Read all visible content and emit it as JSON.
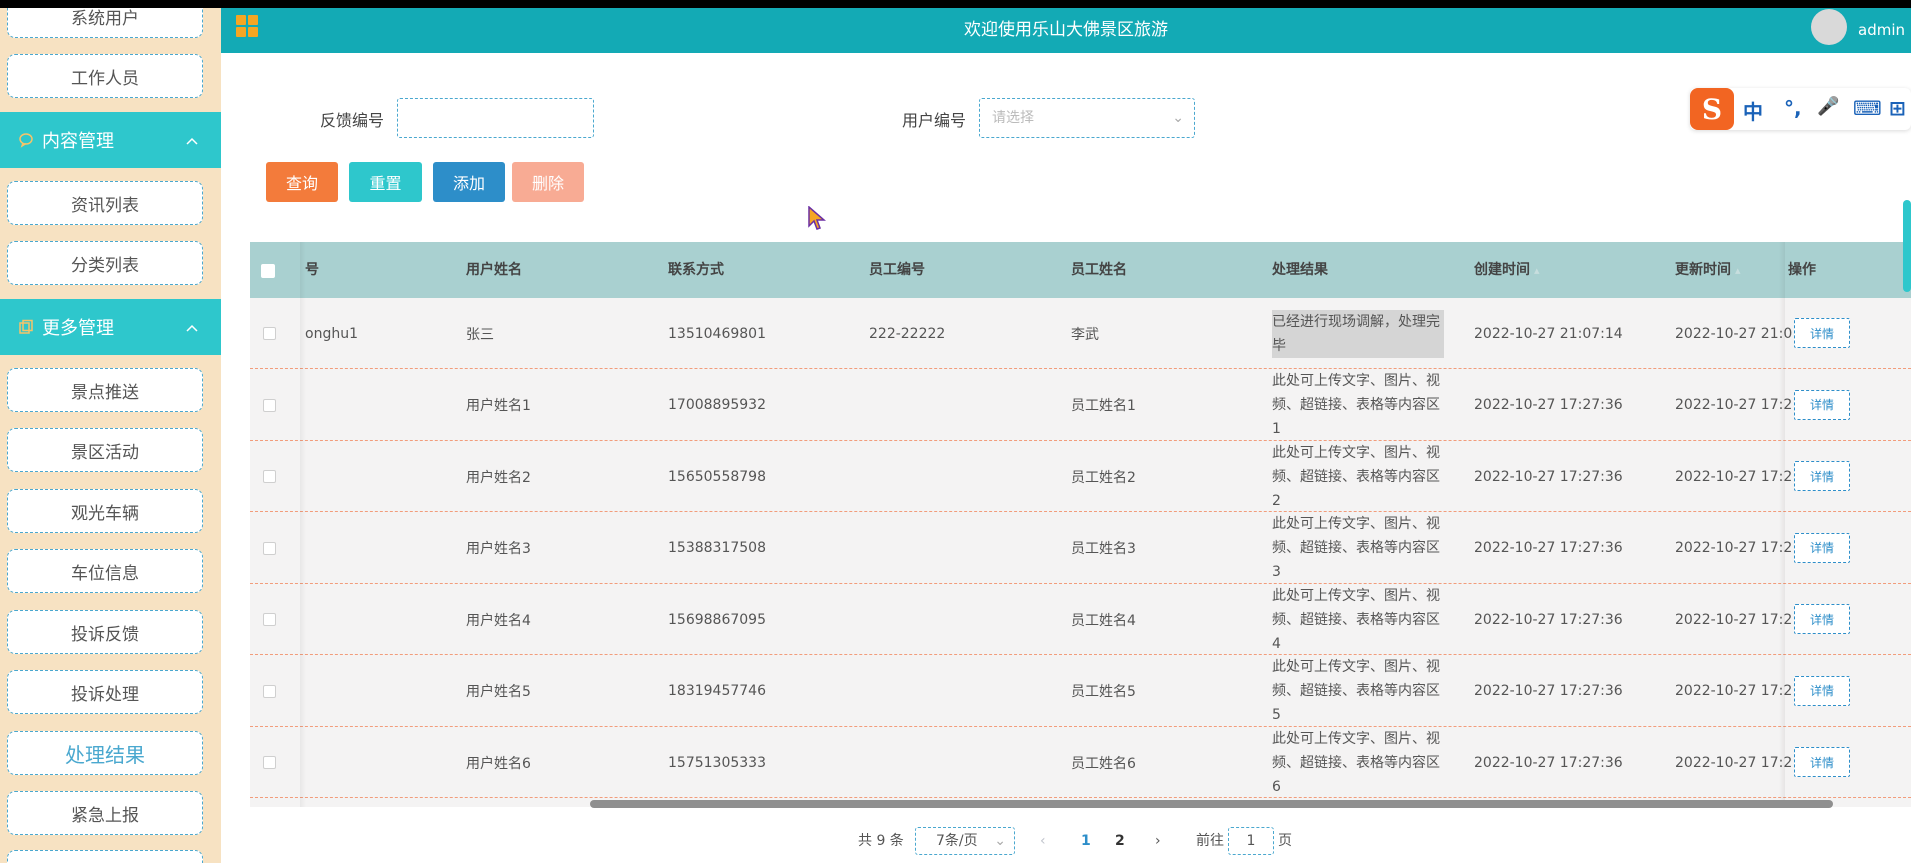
{
  "header": {
    "title": "欢迎使用乐山大佛景区旅游",
    "user": "admin"
  },
  "sidebar": {
    "items_top": [
      {
        "label": "系统用户"
      },
      {
        "label": "工作人员"
      }
    ],
    "group_content": {
      "label": "内容管理"
    },
    "items_content": [
      {
        "label": "资讯列表"
      },
      {
        "label": "分类列表"
      }
    ],
    "group_more": {
      "label": "更多管理"
    },
    "items_more": [
      {
        "label": "景点推送"
      },
      {
        "label": "景区活动"
      },
      {
        "label": "观光车辆"
      },
      {
        "label": "车位信息"
      },
      {
        "label": "投诉反馈"
      },
      {
        "label": "投诉处理"
      },
      {
        "label": "处理结果",
        "active": true
      },
      {
        "label": "紧急上报"
      }
    ]
  },
  "search": {
    "feedback_label": "反馈编号",
    "feedback_value": "",
    "user_label": "用户编号",
    "user_placeholder": "请选择"
  },
  "buttons": {
    "query": "查询",
    "reset": "重置",
    "add": "添加",
    "delete": "删除"
  },
  "ime": {
    "logo": "S",
    "items": [
      "中",
      "°,",
      "🎤",
      "⌨",
      "⊞"
    ]
  },
  "table": {
    "columns": {
      "feedback_no": "号",
      "user_name": "用户姓名",
      "contact": "联系方式",
      "staff_no": "员工编号",
      "staff_name": "员工姓名",
      "result": "处理结果",
      "created": "创建时间",
      "updated": "更新时间",
      "action": "操作"
    },
    "rows": [
      {
        "feedback_no": "onghu1",
        "user_name": "张三",
        "contact": "13510469801",
        "staff_no": "222-22222",
        "staff_name": "李武",
        "result": "已经进行现场调解，处理完毕",
        "created": "2022-10-27 21:07:14",
        "updated": "2022-10-27 21:0",
        "action": "详情"
      },
      {
        "feedback_no": "",
        "user_name": "用户姓名1",
        "contact": "17008895932",
        "staff_no": "",
        "staff_name": "员工姓名1",
        "result": "此处可上传文字、图片、视频、超链接、表格等内容区1",
        "created": "2022-10-27 17:27:36",
        "updated": "2022-10-27 17:2",
        "action": "详情"
      },
      {
        "feedback_no": "",
        "user_name": "用户姓名2",
        "contact": "15650558798",
        "staff_no": "",
        "staff_name": "员工姓名2",
        "result": "此处可上传文字、图片、视频、超链接、表格等内容区2",
        "created": "2022-10-27 17:27:36",
        "updated": "2022-10-27 17:2",
        "action": "详情"
      },
      {
        "feedback_no": "",
        "user_name": "用户姓名3",
        "contact": "15388317508",
        "staff_no": "",
        "staff_name": "员工姓名3",
        "result": "此处可上传文字、图片、视频、超链接、表格等内容区3",
        "created": "2022-10-27 17:27:36",
        "updated": "2022-10-27 17:2",
        "action": "详情"
      },
      {
        "feedback_no": "",
        "user_name": "用户姓名4",
        "contact": "15698867095",
        "staff_no": "",
        "staff_name": "员工姓名4",
        "result": "此处可上传文字、图片、视频、超链接、表格等内容区4",
        "created": "2022-10-27 17:27:36",
        "updated": "2022-10-27 17:2",
        "action": "详情"
      },
      {
        "feedback_no": "",
        "user_name": "用户姓名5",
        "contact": "18319457746",
        "staff_no": "",
        "staff_name": "员工姓名5",
        "result": "此处可上传文字、图片、视频、超链接、表格等内容区5",
        "created": "2022-10-27 17:27:36",
        "updated": "2022-10-27 17:2",
        "action": "详情"
      },
      {
        "feedback_no": "",
        "user_name": "用户姓名6",
        "contact": "15751305333",
        "staff_no": "",
        "staff_name": "员工姓名6",
        "result": "此处可上传文字、图片、视频、超链接、表格等内容区6",
        "created": "2022-10-27 17:27:36",
        "updated": "2022-10-27 17:2",
        "action": "详情"
      }
    ]
  },
  "pagination": {
    "total": "共 9 条",
    "page_size": "7条/页",
    "prev": "‹",
    "pages": [
      "1",
      "2"
    ],
    "current": "1",
    "next": "›",
    "goto_label": "前往",
    "goto_value": "1",
    "goto_suffix": "页"
  },
  "colors": {
    "header": "#13aab5",
    "sidebar_bg": "#f7e2c2",
    "group_bg": "#2ec7cc",
    "query": "#f37b3b",
    "reset": "#2ec7cc",
    "add": "#2d8ec9",
    "delete": "#f8ab94",
    "table_head": "#a9d0d0"
  }
}
